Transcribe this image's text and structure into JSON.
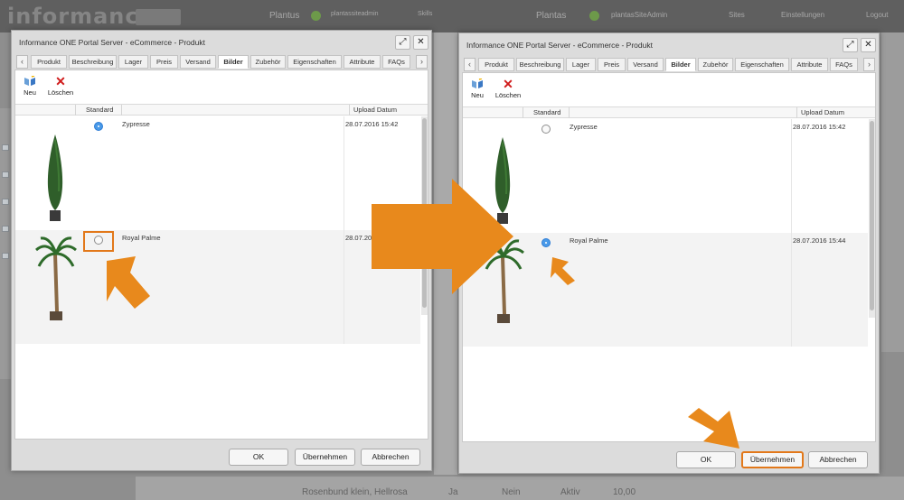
{
  "background": {
    "logo": "informance",
    "top_texts": [
      "Plantus",
      "plantassiteadmin",
      "Skills",
      "Plantas",
      "plantasSiteAdmin",
      "Sites",
      "Einstellungen",
      "Logout"
    ],
    "bottom_row": {
      "name": "Rosenbund klein, Hellrosa",
      "col1": "Ja",
      "col2": "Nein",
      "col3": "Aktiv",
      "price": "10,00"
    }
  },
  "dialogs": [
    {
      "title": "Informance ONE Portal Server - eCommerce - Produkt",
      "tabs": [
        "Produkt",
        "Beschreibung",
        "Lager",
        "Preis",
        "Versand",
        "Bilder",
        "Zubehör",
        "Eigenschaften",
        "Attribute",
        "FAQs"
      ],
      "active_tab": "Bilder",
      "toolbar": {
        "new_label": "Neu",
        "delete_label": "Löschen"
      },
      "columns": {
        "standard": "Standard",
        "upload": "Upload Datum"
      },
      "rows": [
        {
          "name": "Zypresse",
          "date": "28.07.2016 15:42",
          "standard": true
        },
        {
          "name": "Royal Palme",
          "date": "28.07.2016",
          "standard": false
        }
      ],
      "buttons": {
        "ok": "OK",
        "apply": "Übernehmen",
        "cancel": "Abbrechen"
      }
    },
    {
      "title": "Informance ONE Portal Server - eCommerce - Produkt",
      "tabs": [
        "Produkt",
        "Beschreibung",
        "Lager",
        "Preis",
        "Versand",
        "Bilder",
        "Zubehör",
        "Eigenschaften",
        "Attribute",
        "FAQs"
      ],
      "active_tab": "Bilder",
      "toolbar": {
        "new_label": "Neu",
        "delete_label": "Löschen"
      },
      "columns": {
        "standard": "Standard",
        "upload": "Upload Datum"
      },
      "rows": [
        {
          "name": "Zypresse",
          "date": "28.07.2016 15:42",
          "standard": false
        },
        {
          "name": "Royal Palme",
          "date": "28.07.2016 15:44",
          "standard": true
        }
      ],
      "buttons": {
        "ok": "OK",
        "apply": "Übernehmen",
        "cancel": "Abbrechen"
      }
    }
  ],
  "colors": {
    "accent_arrow": "#e8891c",
    "highlight": "#e2781a",
    "radio_selected": "#4a9ae8"
  }
}
